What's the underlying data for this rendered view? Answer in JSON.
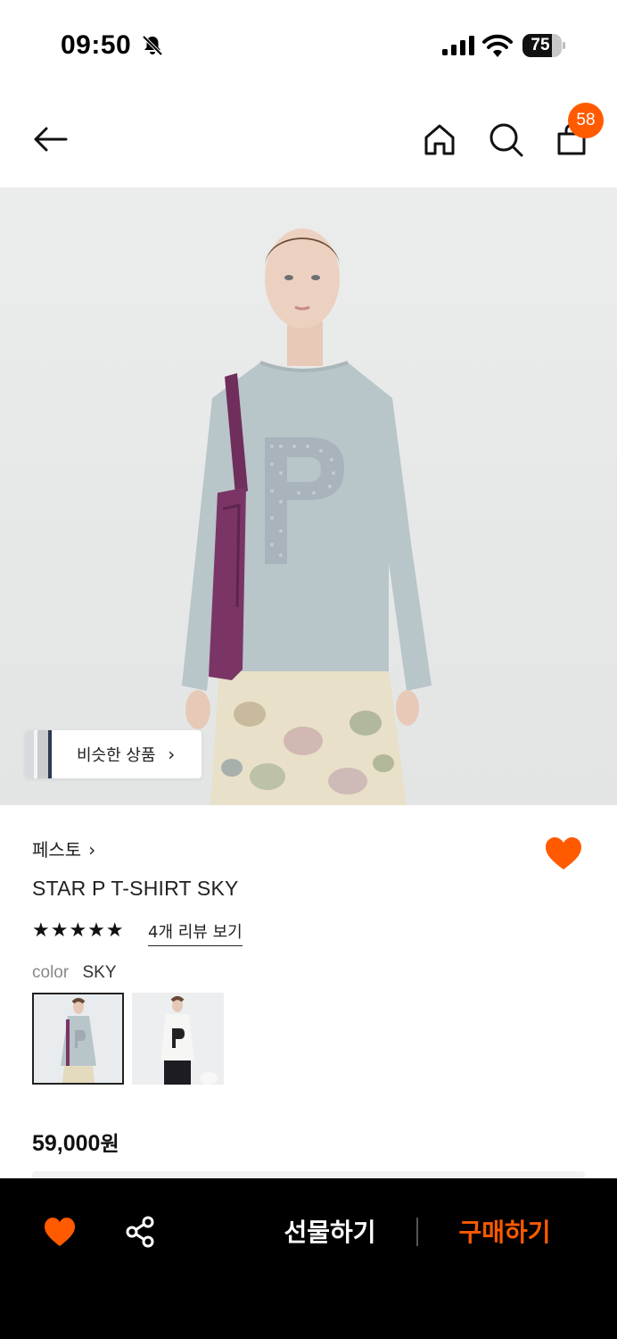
{
  "status_bar": {
    "time": "09:50",
    "battery_percent": "75",
    "battery_level": 0.75,
    "icons": [
      "bell-slash-icon",
      "cellular-signal-icon",
      "wifi-icon",
      "battery-icon"
    ]
  },
  "nav": {
    "icons": [
      "back-arrow-icon",
      "home-icon",
      "search-icon",
      "shopping-bag-icon"
    ],
    "cart_count": "58"
  },
  "hero": {
    "similar_products_label": "비슷한 상품",
    "similar_products_chevron": "›"
  },
  "product": {
    "brand": "페스토",
    "brand_chevron": "›",
    "name": "STAR P T-SHIRT SKY",
    "rating_stars": "★★★★★",
    "rating_value": 5,
    "review_link": "4개 리뷰 보기",
    "color_label": "color",
    "color_value": "SKY",
    "color_swatches": [
      {
        "name": "SKY",
        "selected": true
      },
      {
        "name": "white",
        "selected": false
      }
    ],
    "price": "59,000",
    "price_unit": "원"
  },
  "bottom_bar": {
    "gift_label": "선물하기",
    "buy_label": "구매하기"
  },
  "colors": {
    "accent": "#ff5a00",
    "bottom_bar_bg": "#000000",
    "shirt": "#b7c4c8",
    "bag": "#7a3566"
  }
}
